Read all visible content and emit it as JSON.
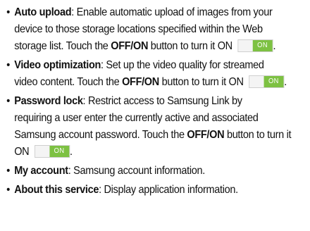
{
  "items": [
    {
      "term": "Auto upload",
      "l1": ": Enable automatic upload of images from your",
      "l2": "device to those storage locations specified within the Web",
      "l3a": "storage list. Touch the ",
      "kw": "OFF/ON",
      "l3b": " button to turn it ON ",
      "toggle": "ON",
      "end": "."
    },
    {
      "term": "Video optimization",
      "l1": ": Set up the video quality for streamed",
      "l2a": "video content. Touch the ",
      "kw": "OFF/ON",
      "l2b": " button to turn it ON ",
      "toggle": "ON",
      "end": "."
    },
    {
      "term": "Password lock",
      "l1": ": Restrict access to Samsung Link by",
      "l2": "requiring a user enter the currently active and associated",
      "l3a": "Samsung account password. Touch the ",
      "kw": "OFF/ON",
      "l3b": " button to turn it",
      "l4": "ON ",
      "toggle": "ON",
      "end": "."
    },
    {
      "term": "My account",
      "l1": ": Samsung account information."
    },
    {
      "term": "About this service",
      "l1": ": Display application information."
    }
  ]
}
